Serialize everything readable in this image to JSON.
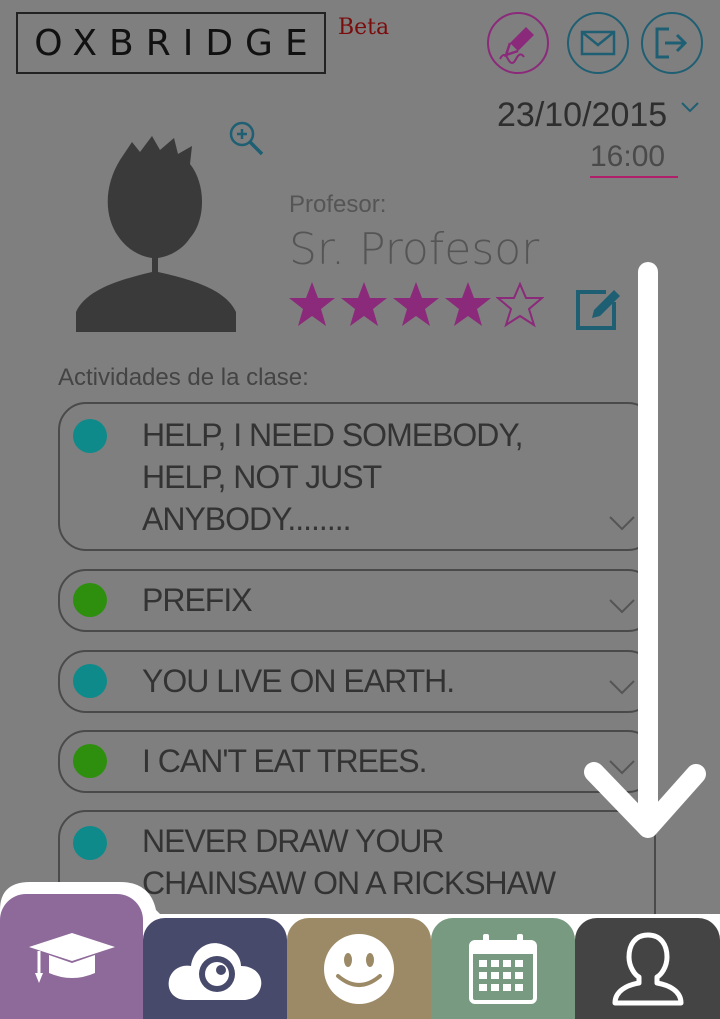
{
  "header": {
    "logo_text": "OXBRIDGE",
    "beta_label": "Beta",
    "icons": [
      "pen-signature-icon",
      "mail-icon",
      "logout-icon"
    ]
  },
  "datetime": {
    "date": "23/10/2015",
    "time": "16:00"
  },
  "teacher": {
    "label": "Profesor:",
    "name": "Sr. Profesor",
    "rating": 4,
    "rating_max": 5
  },
  "activities": {
    "title": "Actividades de la clase:",
    "items": [
      {
        "text": "HELP, I NEED SOMEBODY,\nHELP, NOT JUST\nANYBODY........",
        "status_color": "#0e8a8a"
      },
      {
        "text": "PREFIX",
        "status_color": "#2e8f0e"
      },
      {
        "text": "YOU LIVE ON EARTH.",
        "status_color": "#0e8a8a"
      },
      {
        "text": "I CAN'T EAT TREES.",
        "status_color": "#2e8f0e"
      },
      {
        "text": "NEVER DRAW YOUR\nCHAINSAW ON A RICKSHAW",
        "status_color": "#0e8a8a"
      }
    ]
  },
  "tabs": [
    {
      "icon": "graduation-cap-icon",
      "color": "#8e6a9a"
    },
    {
      "icon": "cloud-eye-icon",
      "color": "#474a6b"
    },
    {
      "icon": "smiley-icon",
      "color": "#9c8a67"
    },
    {
      "icon": "calendar-icon",
      "color": "#779a80"
    },
    {
      "icon": "user-icon",
      "color": "#444444"
    }
  ],
  "colors": {
    "overlay": "#7f7f7f",
    "accent_magenta": "#8b2a7a",
    "accent_teal": "#1f5f73"
  }
}
